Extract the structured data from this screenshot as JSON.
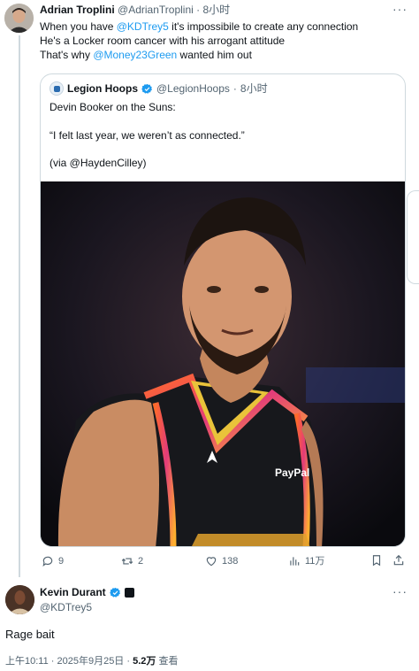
{
  "tweet": {
    "author_name": "Adrian Troplini",
    "author_handle": "@AdrianTroplini",
    "time": "8小时",
    "line1_pre": "When you have ",
    "line1_mention": "@KDTrey5",
    "line1_post": " it's impossibile to create any connection",
    "line2": "He's a Locker room cancer with his arrogant attitude",
    "line3_pre": "That's why ",
    "line3_mention": "@Money23Green",
    "line3_post": " wanted him out"
  },
  "quote": {
    "author_name": "Legion Hoops",
    "author_handle": "@LegionHoops",
    "time": "8小时",
    "line1": "Devin Booker on the Suns:",
    "line2": "“I felt last year, we weren’t as connected.”",
    "line3": "(via @HaydenCilley)"
  },
  "actions": {
    "replies": "9",
    "retweets": "2",
    "likes": "138",
    "views": "11万"
  },
  "reply": {
    "author_name": "Kevin Durant",
    "author_handle": "@KDTrey5",
    "text": "Rage bait",
    "timestamp": "上午10:11 · 2025年9月25日 · ",
    "views_count": "5.2万",
    "views_label": " 查看"
  },
  "colors": {
    "accent": "#1d9bf0",
    "muted": "#536471",
    "border": "#cfd9de"
  }
}
